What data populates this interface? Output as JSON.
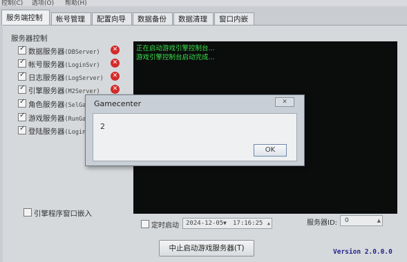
{
  "menu": {
    "items": [
      "控制(C)",
      "选项(O)",
      "帮助(H)"
    ]
  },
  "tabs": [
    {
      "label": "服务端控制",
      "active": true
    },
    {
      "label": "帐号管理"
    },
    {
      "label": "配置向导"
    },
    {
      "label": "数据备份"
    },
    {
      "label": "数据清理"
    },
    {
      "label": "窗口内嵌"
    }
  ],
  "server_control": {
    "title": "服务器控制",
    "services": [
      {
        "label": "数据服务器",
        "name": "(DBServer)",
        "checked": true,
        "error": true
      },
      {
        "label": "帐号服务器",
        "name": "(LoginSvr)",
        "checked": true,
        "error": true
      },
      {
        "label": "日志服务器",
        "name": "(LogServer)",
        "checked": true,
        "error": true
      },
      {
        "label": "引擎服务器",
        "name": "(M2Server)",
        "checked": true,
        "error": true
      },
      {
        "label": "角色服务器",
        "name": "(SelGa",
        "checked": true,
        "error": false
      },
      {
        "label": "游戏服务器",
        "name": "(RunGa",
        "checked": true,
        "error": false
      },
      {
        "label": "登陆服务器",
        "name": "(Login",
        "checked": true,
        "error": false
      }
    ]
  },
  "console": {
    "lines": [
      "正在启动游戏引擎控制台...",
      "游戏引擎控制台启动完成..."
    ],
    "text_color": "#39e24a"
  },
  "embed_window": {
    "label": "引擎程序窗口嵌入",
    "checked": false
  },
  "timed_start": {
    "label": "定时启动",
    "checked": false,
    "date": "2024-12-05",
    "time": "17:16:25"
  },
  "server_id": {
    "label": "服务器ID:",
    "value": "0"
  },
  "start_button": {
    "label": "中止启动游戏服务器(T)"
  },
  "version": "Version 2.0.0.0",
  "dialog": {
    "title": "Gamecenter",
    "close_label": "✕",
    "message": "2",
    "ok_label": "OK"
  }
}
